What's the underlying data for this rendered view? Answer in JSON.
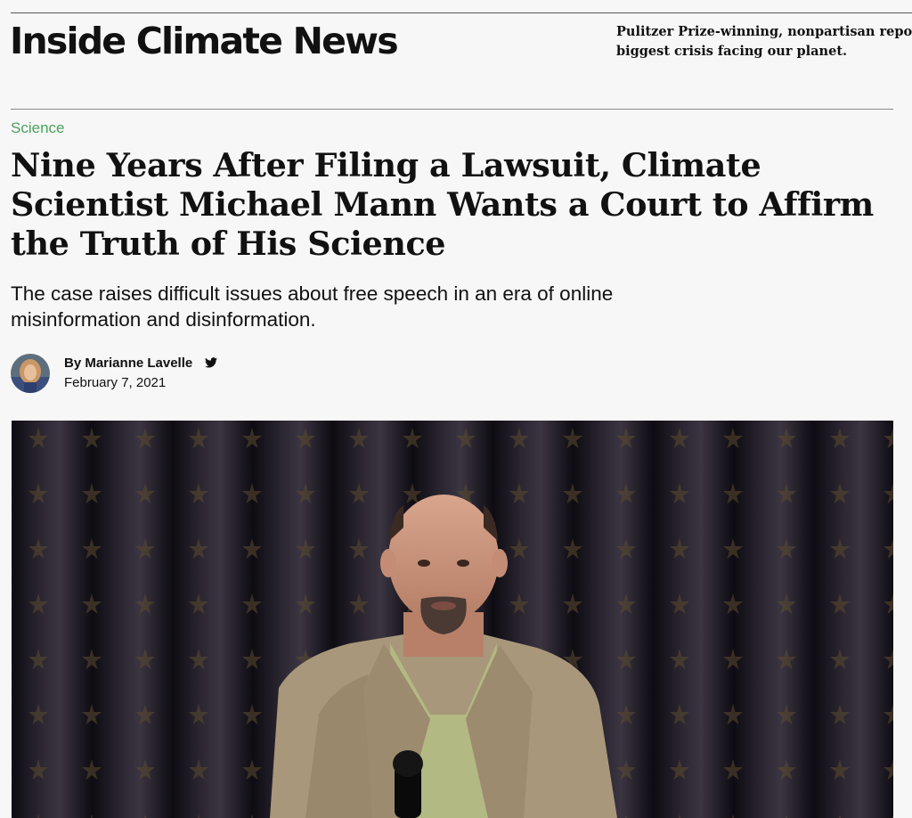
{
  "site": {
    "name": "Inside Climate News",
    "tagline_line1": "Pulitzer Prize-winning, nonpartisan reporting on the",
    "tagline_line2": "biggest crisis facing our planet."
  },
  "article": {
    "category": "Science",
    "headline": "Nine Years After Filing a Lawsuit, Climate Scientist Michael Mann Wants a Court to Affirm the Truth of His Science",
    "dek": "The case raises difficult issues about free speech in an era of online misinformation and disinformation.",
    "byline": "By Marianne Lavelle",
    "date": "February 7, 2021",
    "author_social_icon": "twitter-icon"
  },
  "colors": {
    "category": "#49a35b",
    "background": "#f7f7f7",
    "photo_backdrop": "#141018"
  }
}
